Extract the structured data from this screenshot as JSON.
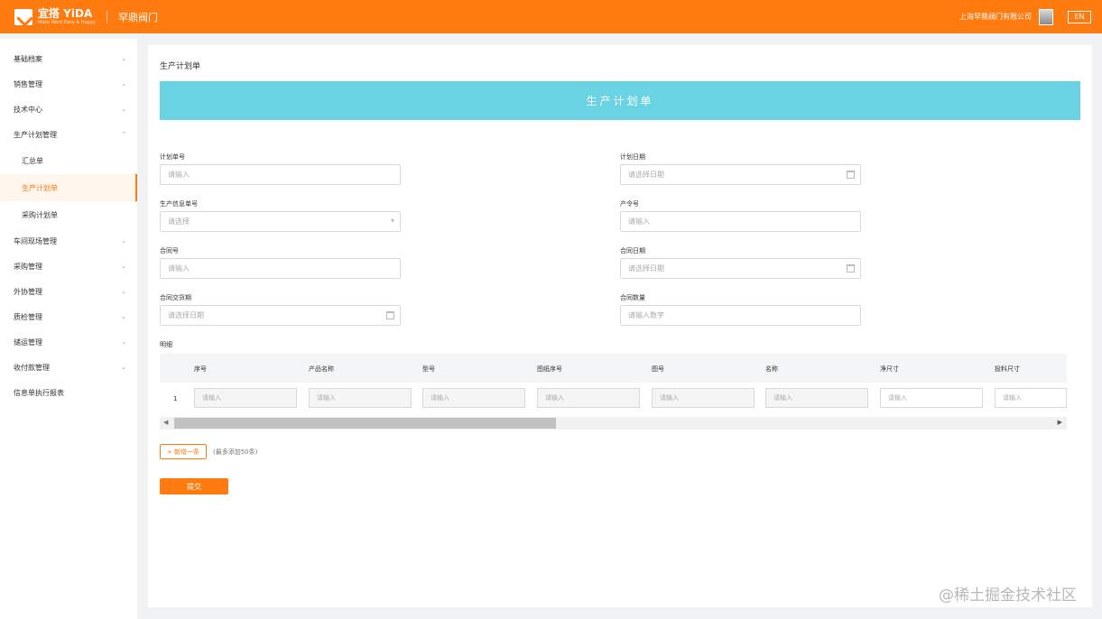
{
  "header": {
    "logo_main": "宜搭 YiDA",
    "logo_sub": "Make Work Easy & Happy",
    "app_name": "罕鼎阀门",
    "company": "上海罕鼎阀门有限公司",
    "lang": "EN",
    "accent_color": "#ff7a0f"
  },
  "sidebar": {
    "items": [
      {
        "label": "基础档案",
        "icon": "chevron-down-icon"
      },
      {
        "label": "销售管理",
        "icon": "chevron-down-icon"
      },
      {
        "label": "技术中心",
        "icon": "chevron-down-icon"
      },
      {
        "label": "生产计划管理",
        "icon": "chevron-up-icon"
      },
      {
        "label": "车间现场管理",
        "icon": "chevron-down-icon"
      },
      {
        "label": "采购管理",
        "icon": "chevron-down-icon"
      },
      {
        "label": "外协管理",
        "icon": "chevron-down-icon"
      },
      {
        "label": "质检管理",
        "icon": "chevron-down-icon"
      },
      {
        "label": "储运管理",
        "icon": "chevron-down-icon"
      },
      {
        "label": "收付款管理",
        "icon": "chevron-down-icon"
      },
      {
        "label": "信息单执行报表"
      }
    ],
    "subitems": [
      {
        "label": "汇总单"
      },
      {
        "label": "生产计划单",
        "active": true
      },
      {
        "label": "采购计划单"
      }
    ]
  },
  "page": {
    "title": "生产计划单",
    "banner": "生产计划单",
    "banner_color": "#69d2e3"
  },
  "form": {
    "plan_no": {
      "label": "计划单号",
      "placeholder": "请输入"
    },
    "plan_date": {
      "label": "计划日期",
      "placeholder": "请选择日期"
    },
    "production_info_no": {
      "label": "生产信息单号",
      "placeholder": "请选择"
    },
    "order_no": {
      "label": "产令号",
      "placeholder": "请输入"
    },
    "contract_no": {
      "label": "合同号",
      "placeholder": "请输入"
    },
    "contract_date": {
      "label": "合同日期",
      "placeholder": "请选择日期"
    },
    "contract_delivery": {
      "label": "合同交货期",
      "placeholder": "请选择日期"
    },
    "contract_qty": {
      "label": "合同数量",
      "placeholder": "请输入数字"
    }
  },
  "detail": {
    "label": "明细",
    "columns": [
      "序号",
      "产品名称",
      "型号",
      "图纸序号",
      "图号",
      "名称",
      "净尺寸",
      "投料尺寸"
    ],
    "row_index": "1",
    "cell_placeholder": "请输入"
  },
  "actions": {
    "add_label": "+ 新增一条",
    "add_hint": "(最多添加50条)",
    "submit_label": "提交"
  },
  "watermark": "@稀土掘金技术社区"
}
